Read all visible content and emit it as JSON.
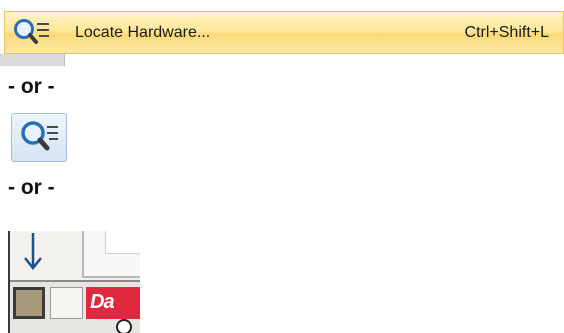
{
  "menu_item": {
    "icon": "magnifier-locate-icon",
    "label": "Locate Hardware...",
    "shortcut": "Ctrl+Shift+L"
  },
  "separators": [
    "- or -",
    "- or -"
  ],
  "toolbar_button": {
    "icon": "magnifier-locate-icon"
  },
  "panel": {
    "arrow_icon": "down-arrow-icon",
    "brand_chip_text": "Da"
  },
  "colors": {
    "menu_highlight": "#fcd979",
    "button_border": "#a9bfd9",
    "brand_red": "#e0283f",
    "arrow_blue": "#1f4e8c"
  }
}
